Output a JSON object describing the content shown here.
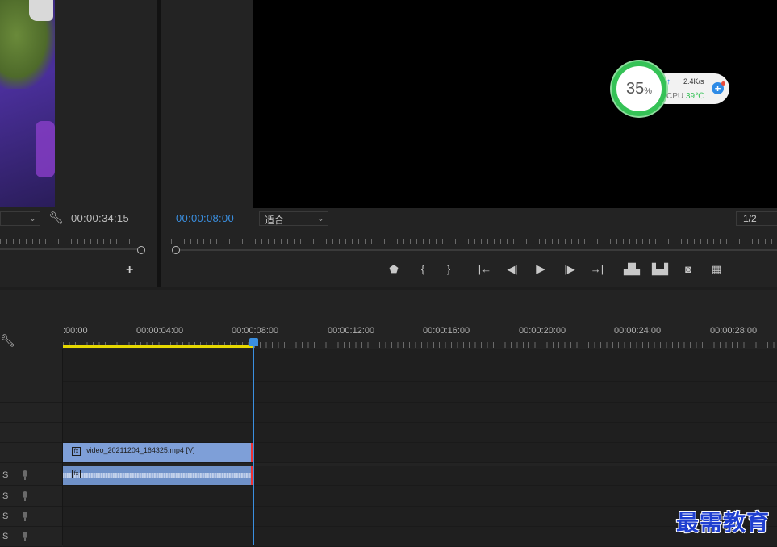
{
  "source_monitor": {
    "timecode": "00:00:34:15"
  },
  "program_monitor": {
    "timecode": "00:00:08:00",
    "zoom": "适合",
    "resolution": "1/2"
  },
  "cpu_widget": {
    "percent": "35",
    "percent_sign": "%",
    "net_speed": "2.4K/s",
    "cpu_label": "CPU",
    "cpu_temp": "39℃",
    "colors": {
      "ring": "#35c256",
      "accent": "#2f8be6"
    }
  },
  "transport_icons": [
    "marker-icon",
    "mark-in-icon",
    "mark-out-icon",
    "go-to-in-icon",
    "step-back-icon",
    "play-icon",
    "step-forward-icon",
    "go-to-out-icon",
    "lift-icon",
    "extract-icon",
    "export-frame-icon",
    "comparison-view-icon"
  ],
  "timeline": {
    "ruler_labels": [
      ":00:00",
      "00:00:04:00",
      "00:00:08:00",
      "00:00:12:00",
      "00:00:16:00",
      "00:00:20:00",
      "00:00:24:00",
      "00:00:28:00"
    ],
    "video_clip_name": "video_20211204_164325.mp4 [V]",
    "audio_track_labels": [
      "S",
      "S",
      "S",
      "S"
    ],
    "fx_badge": "fx",
    "colors": {
      "playhead": "#3a8fe0",
      "video_clip": "#7e9fd8",
      "audio_clip": "#6f91c8",
      "work_area": "#e6d800"
    }
  },
  "watermark": "最需教育"
}
